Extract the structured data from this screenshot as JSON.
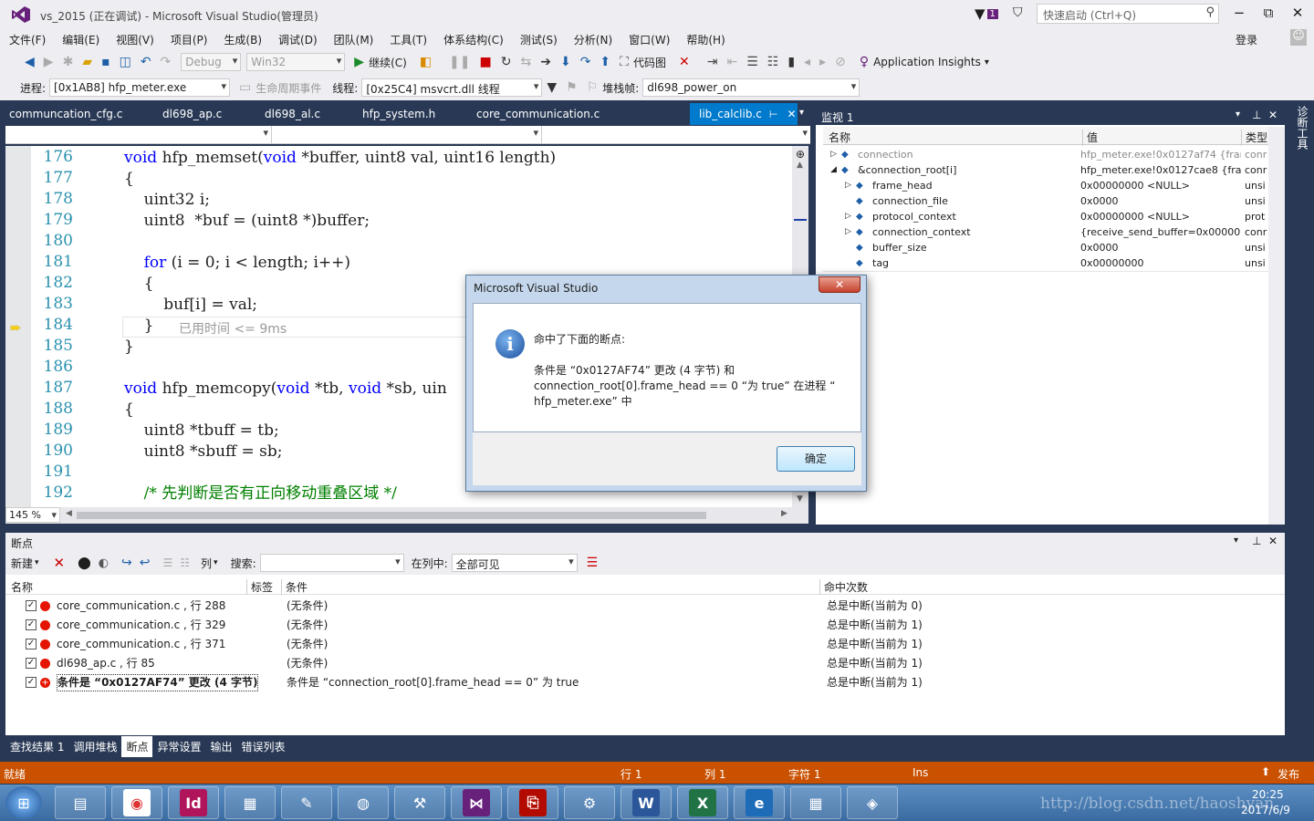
{
  "title": {
    "text": "vs_2015 (正在调试) - Microsoft Visual Studio(管理员)",
    "notify_count": "1",
    "quick_launch_placeholder": "快速启动 (Ctrl+Q)",
    "minimize": "−",
    "maximize": "⧉",
    "close": "✕"
  },
  "menu": {
    "items": [
      "文件(F)",
      "编辑(E)",
      "视图(V)",
      "项目(P)",
      "生成(B)",
      "调试(D)",
      "团队(M)",
      "工具(T)",
      "体系结构(C)",
      "测试(S)",
      "分析(N)",
      "窗口(W)",
      "帮助(H)"
    ],
    "login": "登录"
  },
  "toolbar1": {
    "config": "Debug",
    "platform": "Win32",
    "continue_label": "继续(C)",
    "code_map_label": "代码图",
    "insights_label": "Application Insights"
  },
  "toolbar2": {
    "process_label": "进程:",
    "process_value": "[0x1AB8] hfp_meter.exe",
    "lifecycle_label": "生命周期事件",
    "thread_label": "线程:",
    "thread_value": "[0x25C4] msvcrt.dll 线程",
    "stackframe_label": "堆栈帧:",
    "stackframe_value": "dl698_power_on"
  },
  "editor": {
    "tabs": [
      "communcation_cfg.c",
      "dl698_ap.c",
      "dl698_al.c",
      "hfp_system.h",
      "core_communication.c"
    ],
    "active_tab": "lib_calclib.c",
    "zoom": "145 %",
    "lines": [
      {
        "n": "176",
        "html": "<span class='kw'>void</span> hfp_memset(<span class='kw'>void</span> *buffer, uint8 val, uint16 length)"
      },
      {
        "n": "177",
        "html": "{"
      },
      {
        "n": "178",
        "html": "    uint32 i;"
      },
      {
        "n": "179",
        "html": "    uint8  *buf = (uint8 *)buffer;"
      },
      {
        "n": "180",
        "html": ""
      },
      {
        "n": "181",
        "html": "    <span class='kw'>for</span> (i = 0; i &lt; length; i++)"
      },
      {
        "n": "182",
        "html": "    {"
      },
      {
        "n": "183",
        "html": "        buf[i] = val;"
      },
      {
        "n": "184",
        "html": "    }"
      },
      {
        "n": "185",
        "html": "}"
      },
      {
        "n": "186",
        "html": ""
      },
      {
        "n": "187",
        "html": "<span class='kw'>void</span> hfp_memcopy(<span class='kw'>void</span> *tb, <span class='kw'>void</span> *sb, uin"
      },
      {
        "n": "188",
        "html": "{"
      },
      {
        "n": "189",
        "html": "    uint8 *tbuff = tb;"
      },
      {
        "n": "190",
        "html": "    uint8 *sbuff = sb;"
      },
      {
        "n": "191",
        "html": ""
      },
      {
        "n": "192",
        "html": "    <span class='cm'>/* 先判断是否有正向移动重叠区域 */</span>"
      }
    ],
    "elapsed_hint": "已用时间 <= 9ms"
  },
  "watch": {
    "title": "监视 1",
    "col_name": "名称",
    "col_value": "值",
    "col_type": "类型",
    "rows": [
      {
        "name": "connection",
        "value": "hfp_meter.exe!0x0127af74 {frar",
        "type": "conr",
        "indent": 0,
        "exp": "▷",
        "gray": true
      },
      {
        "name": "&connection_root[i]",
        "value": "hfp_meter.exe!0x0127cae8 {frame",
        "type": "conr",
        "indent": 0,
        "exp": "◢",
        "gray": false
      },
      {
        "name": "frame_head",
        "value": "0x00000000 <NULL>",
        "type": "unsi",
        "indent": 1,
        "exp": "▷",
        "gray": false
      },
      {
        "name": "connection_file",
        "value": "0x0000",
        "type": "unsi",
        "indent": 1,
        "exp": "",
        "gray": false
      },
      {
        "name": "protocol_context",
        "value": "0x00000000 <NULL>",
        "type": "prot",
        "indent": 1,
        "exp": "▷",
        "gray": false
      },
      {
        "name": "connection_context",
        "value": "{receive_send_buffer=0x00000000",
        "type": "conr",
        "indent": 1,
        "exp": "▷",
        "gray": false
      },
      {
        "name": "buffer_size",
        "value": "0x0000",
        "type": "unsi",
        "indent": 1,
        "exp": "",
        "gray": false
      },
      {
        "name": "tag",
        "value": "0x00000000",
        "type": "unsi",
        "indent": 1,
        "exp": "",
        "gray": false
      }
    ]
  },
  "breakpoints": {
    "title": "断点",
    "new_label": "新建",
    "columns_label": "列",
    "search_label": "搜索:",
    "in_column_label": "在列中:",
    "in_column_value": "全部可见",
    "col_name": "名称",
    "col_tag": "标签",
    "col_condition": "条件",
    "col_hitcount": "命中次数",
    "rows": [
      {
        "name": "core_communication.c , 行 288",
        "condition": "(无条件)",
        "hits": "总是中断(当前为 0)",
        "type": "bp"
      },
      {
        "name": "core_communication.c , 行 329",
        "condition": "(无条件)",
        "hits": "总是中断(当前为 1)",
        "type": "bp"
      },
      {
        "name": "core_communication.c , 行 371",
        "condition": "(无条件)",
        "hits": "总是中断(当前为 1)",
        "type": "bp"
      },
      {
        "name": "dl698_ap.c , 行 85",
        "condition": "(无条件)",
        "hits": "总是中断(当前为 1)",
        "type": "bp"
      },
      {
        "name": "条件是 “0x0127AF74” 更改 (4 字节)",
        "condition": "条件是 “connection_root[0].frame_head == 0” 为 true",
        "hits": "总是中断(当前为 1)",
        "type": "data"
      }
    ]
  },
  "bottom_tabs": [
    "查找结果 1",
    "调用堆栈",
    "断点",
    "异常设置",
    "输出",
    "错误列表"
  ],
  "bottom_active": "断点",
  "diagnostics_label": "诊断工具",
  "status": {
    "ready": "就绪",
    "line": "行 1",
    "col": "列 1",
    "char": "字符 1",
    "ins": "Ins",
    "publish": "发布"
  },
  "taskbar": {
    "time": "20:25",
    "date": "2017/6/9",
    "watermark": "http://blog.csdn.net/haoshyan",
    "apps": [
      "folder",
      "chrome",
      "indesign",
      "game",
      "duck",
      "browser",
      "tool",
      "vs",
      "pdf",
      "wrench",
      "word",
      "excel",
      "ie",
      "calc",
      "box"
    ]
  },
  "dialog": {
    "title": "Microsoft Visual Studio",
    "heading": "命中了下面的断点:",
    "line1": "条件是 “0x0127AF74” 更改 (4 字节) 和",
    "line2": "connection_root[0].frame_head == 0 “为 true” 在进程 “",
    "line3": "hfp_meter.exe” 中",
    "ok": "确定"
  },
  "colors": {
    "accent": "#007acc",
    "status": "#ca5100",
    "breakpoint": "#e51400"
  }
}
